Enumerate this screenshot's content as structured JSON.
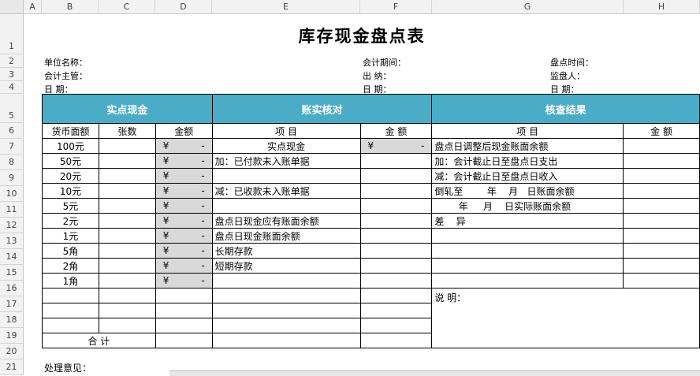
{
  "title": "库存现金盘点表",
  "columns": [
    "A",
    "B",
    "C",
    "D",
    "E",
    "F",
    "G",
    "H"
  ],
  "rows": [
    "1",
    "2",
    "3",
    "4",
    "5",
    "6",
    "7",
    "8",
    "9",
    "10",
    "11",
    "12",
    "13",
    "14",
    "15",
    "16",
    "17",
    "18",
    "19",
    "20",
    "21"
  ],
  "info": {
    "unit_name": "单位名称：",
    "accounting_supervisor": "会计主管：",
    "date1": "日    期：",
    "accounting_period": "会计期间：",
    "cashier": "出    纳：",
    "date2": "日    期：",
    "count_time": "盘点时间：",
    "supervisor": "监盘人：",
    "date3": "日    期："
  },
  "headers": {
    "actual_cash": "实点现金",
    "reconciliation": "账实核对",
    "check_result": "核查结果"
  },
  "subheaders": {
    "denomination": "货币面额",
    "count": "张数",
    "amount": "金额",
    "item": "项      目",
    "amount2": "金  额",
    "item2": "项      目",
    "amount3": "金  额"
  },
  "denominations": [
    "100元",
    "50元",
    "20元",
    "10元",
    "5元",
    "2元",
    "1元",
    "5角",
    "2角",
    "1角"
  ],
  "yen_symbol": "¥",
  "dash": "-",
  "recon_items": {
    "r7": "实点现金",
    "r8": "加：已付款未入账单据",
    "r10": "减：已收款未入账单据",
    "r12": "盘点日现金应有账面余额",
    "r13": "盘点日现金账面余额",
    "r14": "长期存款",
    "r15": "短期存款"
  },
  "result_items": {
    "r7": "盘点日调整后现金账面余额",
    "r8": "加：会计截止日至盘点日支出",
    "r9": "减：会计截止日至盘点日收入",
    "r10": "倒轧至        年    月   日账面余额",
    "r11": "        年     月    日实际账面余额",
    "r12": "差    异",
    "r17": "说    明："
  },
  "total": "合    计",
  "opinion": "处理意见："
}
